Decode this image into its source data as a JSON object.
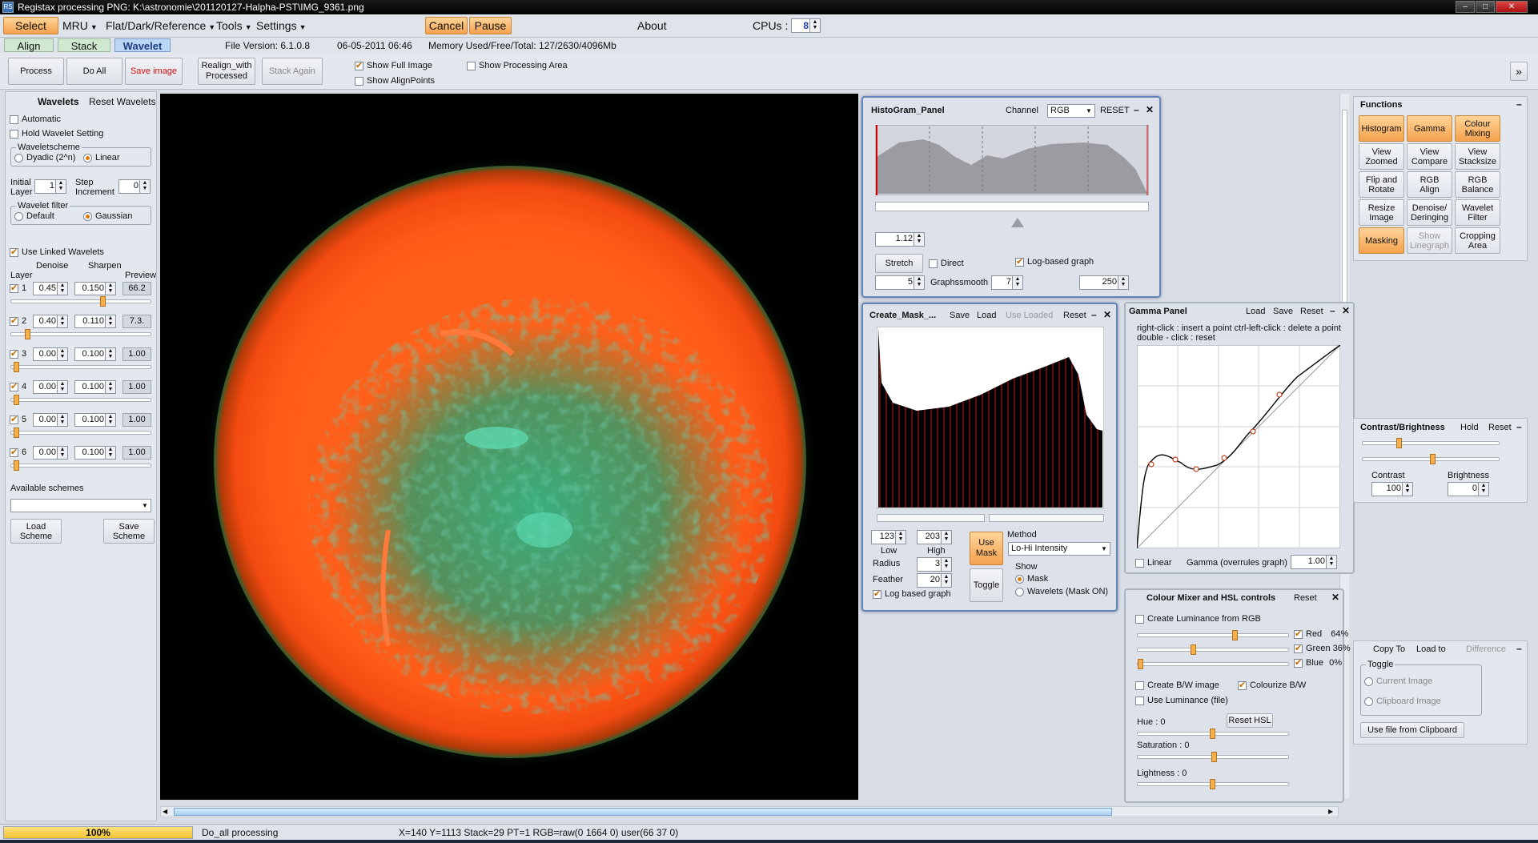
{
  "window": {
    "title": "Registax processing PNG: K:\\astronomie\\201120127-Halpha-PST\\IMG_9361.png",
    "icon_label": "RS"
  },
  "menu": {
    "select": "Select",
    "mru": "MRU",
    "flat": "Flat/Dark/Reference",
    "tools": "Tools",
    "settings": "Settings",
    "cancel": "Cancel",
    "pause": "Pause",
    "about": "About",
    "cpus_label": "CPUs :",
    "cpus_value": "8"
  },
  "tabs": {
    "align": "Align",
    "stack": "Stack",
    "wavelet": "Wavelet"
  },
  "info": {
    "file_version": "File Version: 6.1.0.8",
    "date": "06-05-2011 06:46",
    "memory": "Memory Used/Free/Total: 127/2630/4096Mb"
  },
  "toolbar": {
    "process": "Process",
    "do_all": "Do All",
    "save_image": "Save image",
    "realign_1": "Realign_with",
    "realign_2": "Processed",
    "stack_again": "Stack Again",
    "show_full_image": "Show Full Image",
    "show_alignpoints": "Show AlignPoints",
    "show_processing_area": "Show Processing Area",
    "expand": "»"
  },
  "wavelets": {
    "title": "Wavelets",
    "reset": "Reset Wavelets",
    "automatic": "Automatic",
    "hold": "Hold Wavelet Setting",
    "scheme_group": "Waveletscheme",
    "dyadic": "Dyadic (2^n)",
    "linear": "Linear",
    "initial_layer_1": "Initial",
    "initial_layer_2": "Layer",
    "initial_layer_value": "1",
    "step_1": "Step",
    "step_2": "Increment",
    "step_value": "0",
    "filter_group": "Wavelet filter",
    "default": "Default",
    "gaussian": "Gaussian",
    "use_linked": "Use Linked Wavelets",
    "col_layer": "Layer",
    "col_denoise": "Denoise",
    "col_sharpen": "Sharpen",
    "col_preview": "Preview",
    "layers": [
      {
        "n": "1",
        "denoise": "0.45",
        "sharpen": "0.150",
        "preview": "66.2",
        "slider": 0.65
      },
      {
        "n": "2",
        "denoise": "0.40",
        "sharpen": "0.110",
        "preview": "7.3.",
        "slider": 0.1
      },
      {
        "n": "3",
        "denoise": "0.00",
        "sharpen": "0.100",
        "preview": "1.00",
        "slider": 0.02
      },
      {
        "n": "4",
        "denoise": "0.00",
        "sharpen": "0.100",
        "preview": "1.00",
        "slider": 0.02
      },
      {
        "n": "5",
        "denoise": "0.00",
        "sharpen": "0.100",
        "preview": "1.00",
        "slider": 0.02
      },
      {
        "n": "6",
        "denoise": "0.00",
        "sharpen": "0.100",
        "preview": "1.00",
        "slider": 0.02
      }
    ],
    "available_schemes": "Available schemes",
    "load_scheme_1": "Load",
    "load_scheme_2": "Scheme",
    "save_scheme_1": "Save",
    "save_scheme_2": "Scheme"
  },
  "histogram": {
    "title": "HistoGram_Panel",
    "channel_label": "Channel",
    "channel_value": "RGB",
    "reset": "RESET",
    "value_1": "1.12",
    "stretch": "Stretch",
    "direct": "Direct",
    "log_graph": "Log-based graph",
    "value_2": "5",
    "graphsmooth_label": "Graphssmooth",
    "graphsmooth_value": "7",
    "value_3": "250"
  },
  "create_mask": {
    "title": "Create_Mask_...",
    "save": "Save",
    "load": "Load",
    "use_loaded": "Use Loaded",
    "reset": "Reset",
    "low_value": "123",
    "high_value": "203",
    "low": "Low",
    "high": "High",
    "radius_label": "Radius",
    "radius_value": "3",
    "feather_label": "Feather",
    "feather_value": "20",
    "use_mask_1": "Use",
    "use_mask_2": "Mask",
    "toggle": "Toggle",
    "method_label": "Method",
    "method_value": "Lo-Hi Intensity",
    "show_label": "Show",
    "show_mask": "Mask",
    "show_wavelets": "Wavelets (Mask ON)",
    "log_graph": "Log based graph"
  },
  "gamma": {
    "title": "Gamma Panel",
    "load": "Load",
    "save": "Save",
    "reset": "Reset",
    "help_1": "right-click : insert a point   ctrl-left-click : delete a point",
    "help_2": "double - click : reset",
    "linear": "Linear",
    "gamma_label": "Gamma (overrules graph)",
    "gamma_value": "1.00"
  },
  "colour_mixer": {
    "title": "Colour Mixer and HSL controls",
    "reset": "Reset",
    "create_lum": "Create Luminance from RGB",
    "red": "Red",
    "red_val": "64%",
    "green": "Green",
    "green_val": "36%",
    "blue": "Blue",
    "blue_val": "0%",
    "red_pos": 0.64,
    "green_pos": 0.36,
    "blue_pos": 0.0,
    "create_bw": "Create B/W image",
    "colourize_bw": "Colourize B/W",
    "use_lum_file": "Use Luminance (file)",
    "hue": "Hue : 0",
    "reset_hsl": "Reset HSL",
    "saturation": "Saturation : 0",
    "lightness": "Lightness : 0"
  },
  "functions": {
    "title": "Functions",
    "buttons": [
      [
        "Histogram",
        ""
      ],
      [
        "Gamma",
        ""
      ],
      [
        "Colour",
        "Mixing"
      ],
      [
        "View",
        "Zoomed"
      ],
      [
        "View",
        "Compare"
      ],
      [
        "View",
        "Stacksize"
      ],
      [
        "Flip and",
        "Rotate"
      ],
      [
        "RGB",
        "Align"
      ],
      [
        "RGB",
        "Balance"
      ],
      [
        "Resize",
        "Image"
      ],
      [
        "Denoise/",
        "Deringing"
      ],
      [
        "Wavelet",
        "Filter"
      ],
      [
        "Masking",
        ""
      ],
      [
        "Show",
        "Linegraph"
      ],
      [
        "Cropping",
        "Area"
      ]
    ]
  },
  "contrast": {
    "title": "Contrast/Brightness",
    "hold": "Hold",
    "reset": "Reset",
    "contrast_label": "Contrast",
    "contrast_value": "100",
    "brightness_label": "Brightness",
    "brightness_value": "0"
  },
  "copy": {
    "copy_to": "Copy To",
    "load_to": "Load to",
    "difference": "Difference",
    "toggle": "Toggle",
    "current_image": "Current Image",
    "clipboard_image": "Clipboard Image",
    "use_file": "Use file from Clipboard"
  },
  "status": {
    "progress": "100%",
    "progress_value": 1.0,
    "message": "Do_all processing",
    "coords": "X=140 Y=1113 Stack=29 PT=1 RGB=raw(0 1664 0) user(66 37 0)"
  },
  "colors": {
    "accent_orange": "#f4a24c",
    "sun_orange": "#ff5a1c",
    "sun_green": "#1fa070"
  }
}
